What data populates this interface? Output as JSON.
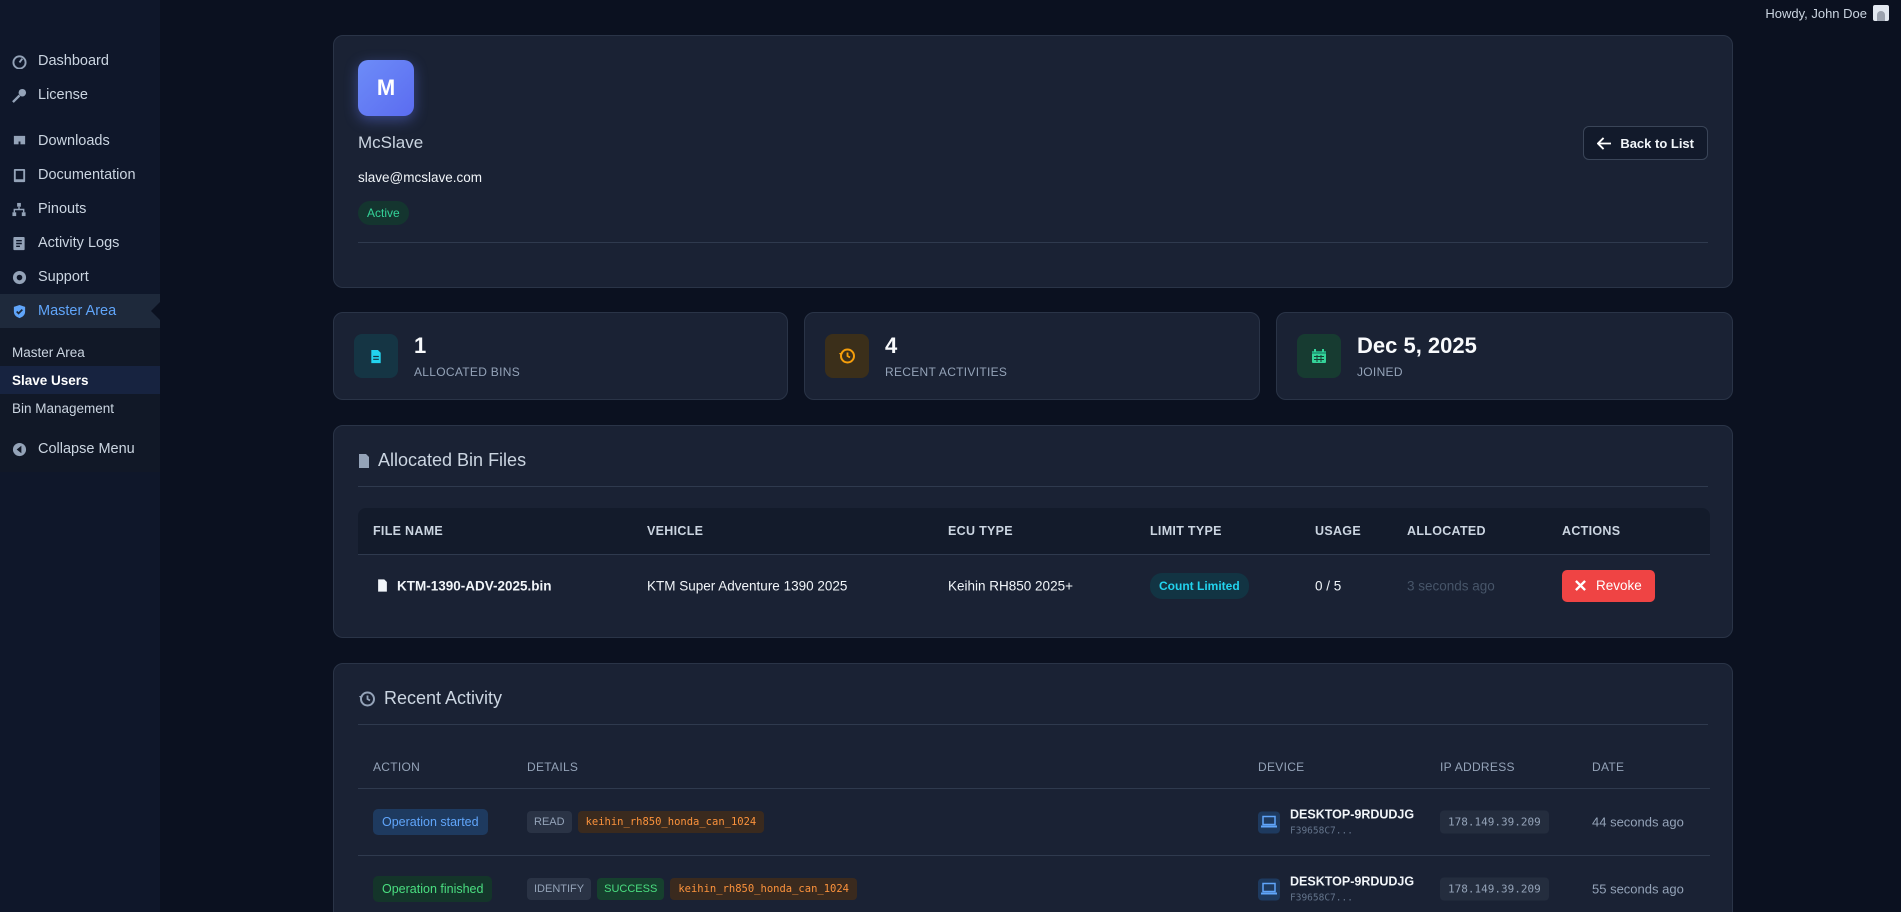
{
  "topbar": {
    "howdy": "Howdy, John Doe"
  },
  "sidebar": {
    "items": [
      {
        "label": "Dashboard",
        "icon": "dashboard-icon"
      },
      {
        "label": "License",
        "icon": "key-icon"
      },
      {
        "label": "Downloads",
        "icon": "download-icon"
      },
      {
        "label": "Documentation",
        "icon": "book-icon"
      },
      {
        "label": "Pinouts",
        "icon": "sitemap-icon"
      },
      {
        "label": "Activity Logs",
        "icon": "log-icon"
      },
      {
        "label": "Support",
        "icon": "lifebuoy-icon"
      },
      {
        "label": "Master Area",
        "icon": "shield-icon"
      }
    ],
    "submenu": [
      "Master Area",
      "Slave Users",
      "Bin Management"
    ],
    "collapse_label": "Collapse Menu"
  },
  "profile": {
    "initial": "M",
    "name": "McSlave",
    "email": "slave@mcslave.com",
    "status": "Active",
    "back_label": "Back to List"
  },
  "stats": [
    {
      "value": "1",
      "label": "ALLOCATED BINS",
      "icon": "file-icon",
      "color": "#22d3ee"
    },
    {
      "value": "4",
      "label": "RECENT ACTIVITIES",
      "icon": "history-icon",
      "color": "#f59e0b"
    },
    {
      "value": "Dec 5, 2025",
      "label": "JOINED",
      "icon": "calendar-icon",
      "color": "#34d399"
    }
  ],
  "bins": {
    "title": "Allocated Bin Files",
    "headers": [
      "FILE NAME",
      "VEHICLE",
      "ECU TYPE",
      "LIMIT TYPE",
      "USAGE",
      "ALLOCATED",
      "ACTIONS"
    ],
    "rows": [
      {
        "file": "KTM-1390-ADV-2025.bin",
        "vehicle": "KTM Super Adventure 1390 2025",
        "ecu": "Keihin RH850 2025+",
        "limit": "Count Limited",
        "usage": "0 / 5",
        "allocated": "3 seconds ago",
        "action": "Revoke"
      }
    ]
  },
  "activity": {
    "title": "Recent Activity",
    "headers": [
      "ACTION",
      "DETAILS",
      "DEVICE",
      "IP ADDRESS",
      "DATE"
    ],
    "rows": [
      {
        "action": "Operation started",
        "tags": [
          "READ"
        ],
        "code": "keihin_rh850_honda_can_1024",
        "device": "DESKTOP-9RDUDJG",
        "device_id": "F39658C7...",
        "ip": "178.149.39.209",
        "date": "44 seconds ago"
      },
      {
        "action": "Operation finished",
        "tags": [
          "IDENTIFY"
        ],
        "success": "SUCCESS",
        "code": "keihin_rh850_honda_can_1024",
        "device": "DESKTOP-9RDUDJG",
        "device_id": "F39658C7...",
        "ip": "178.149.39.209",
        "date": "55 seconds ago"
      }
    ]
  }
}
